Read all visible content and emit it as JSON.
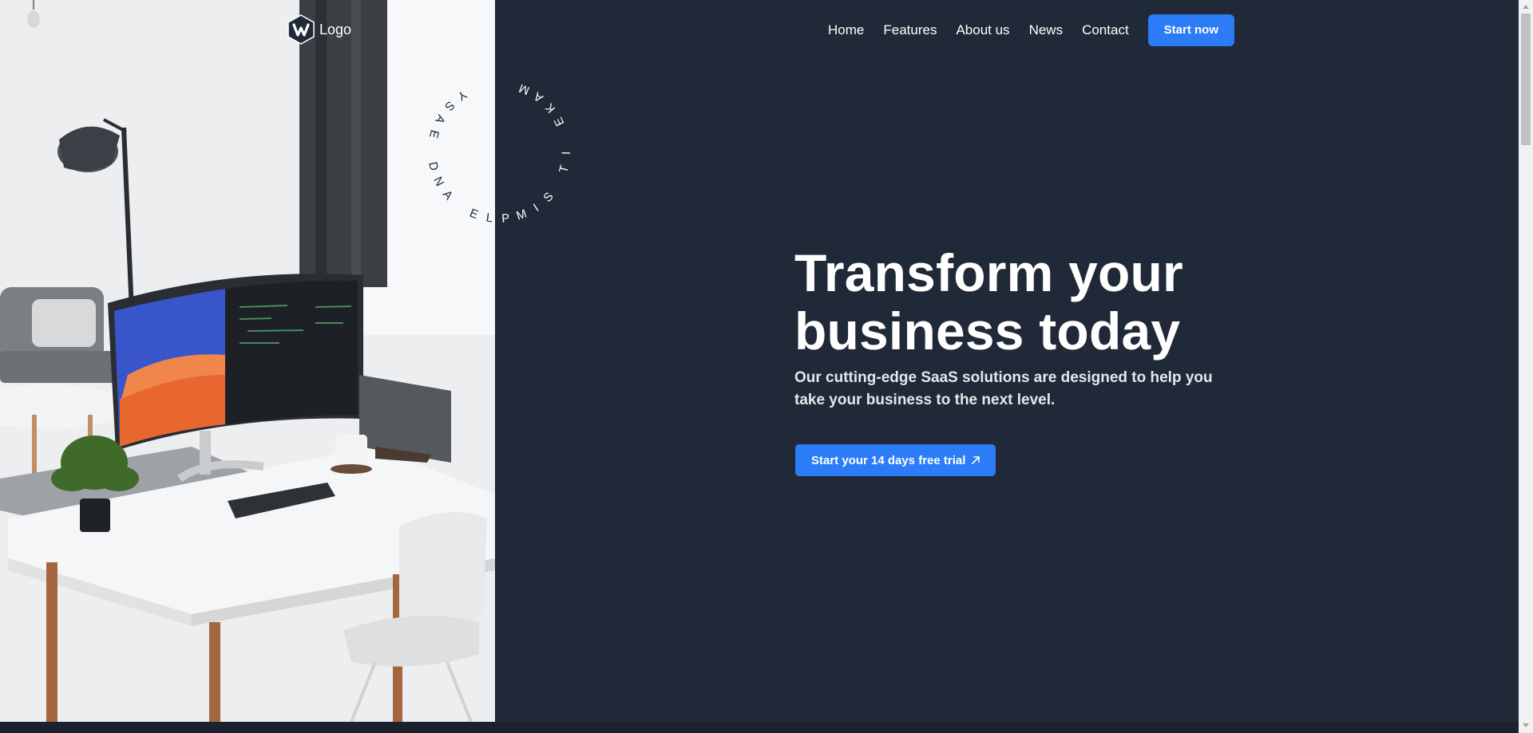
{
  "brand": {
    "logo_text": "Logo"
  },
  "nav": {
    "links": [
      "Home",
      "Features",
      "About us",
      "News",
      "Contact"
    ],
    "cta_label": "Start now"
  },
  "hero": {
    "title": "Transform your business today",
    "subtitle": "Our cutting-edge SaaS solutions are designed to help you take your business to the next level.",
    "cta_label": "Start your 14 days free trial"
  },
  "decorative": {
    "circular_text": "MAKE IT SIMPLE AND EASY"
  },
  "colors": {
    "page_bg": "#1f2937",
    "accent": "#2b7cf6",
    "text": "#ffffff"
  },
  "icons": {
    "logo": "hexagon-logo-icon",
    "cta": "arrow-up-right-icon"
  }
}
